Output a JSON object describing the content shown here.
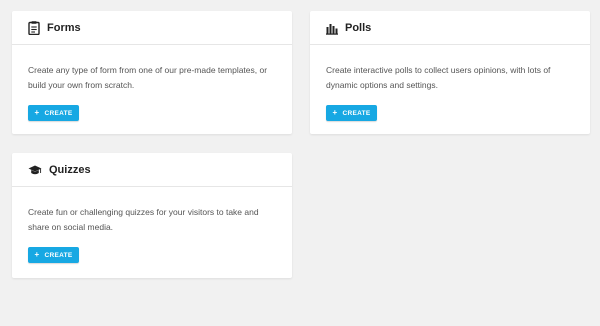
{
  "cards": [
    {
      "title": "Forms",
      "icon": "clipboard-icon",
      "description": "Create any type of form from one of our pre-made templates, or build your own from scratch.",
      "button_label": "CREATE"
    },
    {
      "title": "Polls",
      "icon": "bar-chart-icon",
      "description": "Create interactive polls to collect users opinions, with lots of dynamic options and settings.",
      "button_label": "CREATE"
    },
    {
      "title": "Quizzes",
      "icon": "graduation-cap-icon",
      "description": "Create fun or challenging quizzes for your visitors to take and share on social media.",
      "button_label": "CREATE"
    }
  ],
  "colors": {
    "accent": "#17a8e3",
    "background": "#f1f1f1",
    "card": "#ffffff"
  },
  "button_icon": "plus-icon",
  "button_icon_glyph": "+"
}
